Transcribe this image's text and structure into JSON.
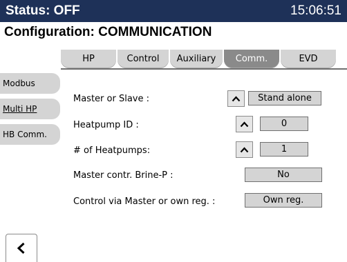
{
  "status_bar": {
    "status": "Status: OFF",
    "time": "15:06:51"
  },
  "page": {
    "title": "Configuration: COMMUNICATION"
  },
  "tabs": [
    {
      "label": "HP"
    },
    {
      "label": "Control"
    },
    {
      "label": "Auxiliary"
    },
    {
      "label": "Comm.",
      "active": true
    },
    {
      "label": "EVD"
    }
  ],
  "side_tabs": [
    {
      "label": "Modbus"
    },
    {
      "label": "Multi HP"
    },
    {
      "label": "HB Comm."
    }
  ],
  "settings": [
    {
      "label": "Master or Slave :",
      "value": "Stand alone"
    },
    {
      "label": "Heatpump ID :",
      "value": "0"
    },
    {
      "label": "# of Heatpumps:",
      "value": "1"
    },
    {
      "label": "Master contr. Brine-P :",
      "value": "No"
    },
    {
      "label": "Control via Master or own reg. :",
      "value": "Own reg."
    }
  ],
  "icons": {
    "up_arrow": "chevron-up-icon",
    "back": "chevron-left-icon"
  },
  "colors": {
    "status_bar_bg": "#1e3158",
    "tab_bg": "#d4d4d4",
    "active_tab_bg": "#8a8a8a"
  }
}
